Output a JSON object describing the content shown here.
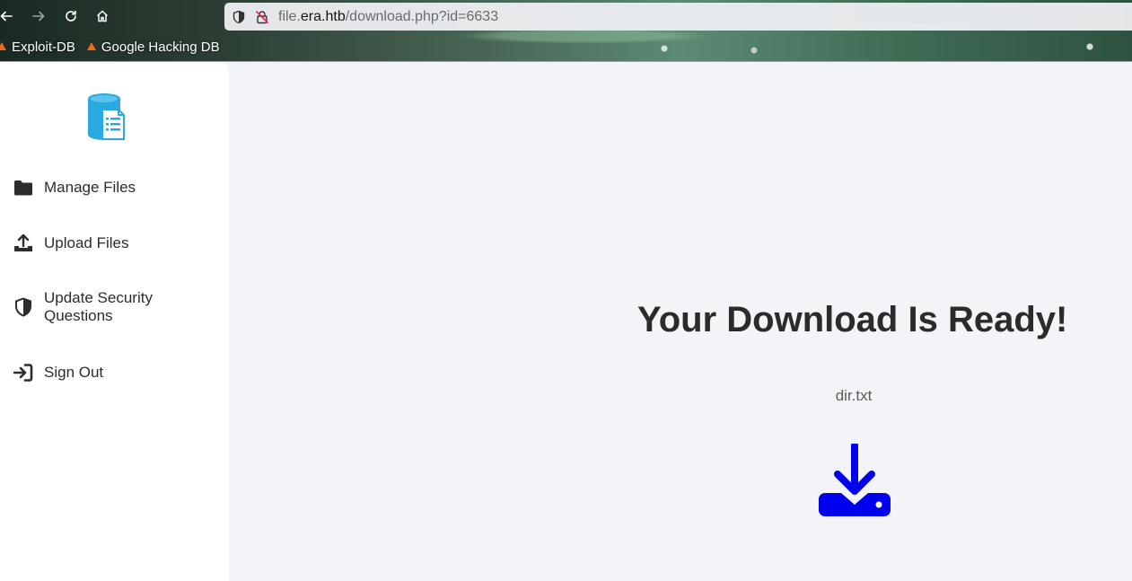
{
  "browser": {
    "url_prefix": "file.",
    "url_domain": "era.htb",
    "url_path": "/download.php?id=6633",
    "bookmarks": [
      {
        "label": "Exploit-DB",
        "icon": "exploitdb-icon"
      },
      {
        "label": "Google Hacking DB",
        "icon": "ghdb-icon"
      }
    ]
  },
  "sidebar": {
    "logo_icon": "file-storage-logo-icon",
    "items": [
      {
        "label": "Manage Files",
        "icon": "folder-icon"
      },
      {
        "label": "Upload Files",
        "icon": "upload-icon"
      },
      {
        "label": "Update Security Questions",
        "icon": "shield-icon"
      },
      {
        "label": "Sign Out",
        "icon": "sign-out-icon"
      }
    ]
  },
  "main": {
    "headline": "Your Download Is Ready!",
    "filename": "dir.txt",
    "download_icon": "download-icon"
  },
  "colors": {
    "accent": "#0000ee",
    "logo": "#29a9e0",
    "page_bg": "#f3f4f8",
    "sidebar_bg": "#ffffff"
  }
}
